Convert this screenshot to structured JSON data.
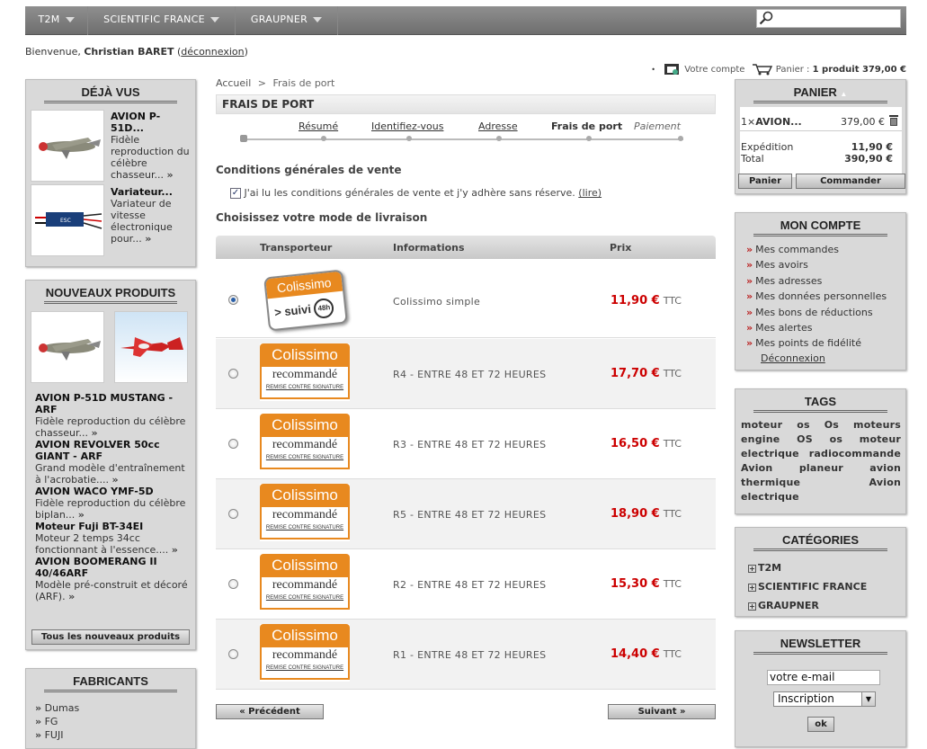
{
  "nav": {
    "items": [
      "T2M",
      "SCIENTIFIC FRANCE",
      "GRAUPNER"
    ]
  },
  "welcome": {
    "prefix": "Bienvenue, ",
    "name": "Christian BARET",
    "logout": "déconnexion"
  },
  "user_bar": {
    "account": "Votre compte",
    "cart_label": "Panier :",
    "cart_summary": "1 produit 379,00 €"
  },
  "breadcrumb": {
    "home": "Accueil",
    "sep": ">",
    "current": "Frais de port"
  },
  "page_title": "FRAIS DE PORT",
  "steps": [
    "Résumé",
    "Identifiez-vous",
    "Adresse",
    "Frais de port",
    "Paiement"
  ],
  "cgv": {
    "heading": "Conditions générales de vente",
    "text": "J'ai lu les conditions générales de vente et j'y adhère sans réserve.",
    "link": "(lire)"
  },
  "delivery_heading": "Choisissez votre mode de livraison",
  "table_headers": [
    "Transporteur",
    "Informations",
    "Prix"
  ],
  "carriers": [
    {
      "logo": "colissimo-suivi",
      "info": "Colissimo simple",
      "price": "11,90 €",
      "tax": "TTC",
      "selected": true
    },
    {
      "logo": "colissimo-recommande",
      "info": "R4 - ENTRE 48 ET 72 HEURES",
      "price": "17,70 €",
      "tax": "TTC",
      "selected": false
    },
    {
      "logo": "colissimo-recommande",
      "info": "R3 - ENTRE 48 ET 72 HEURES",
      "price": "16,50 €",
      "tax": "TTC",
      "selected": false
    },
    {
      "logo": "colissimo-recommande",
      "info": "R5 - ENTRE 48 ET 72 HEURES",
      "price": "18,90 €",
      "tax": "TTC",
      "selected": false
    },
    {
      "logo": "colissimo-recommande",
      "info": "R2 - ENTRE 48 ET 72 HEURES",
      "price": "15,30 €",
      "tax": "TTC",
      "selected": false
    },
    {
      "logo": "colissimo-recommande",
      "info": "R1 - ENTRE 48 ET 72 HEURES",
      "price": "14,40 €",
      "tax": "TTC",
      "selected": false
    }
  ],
  "logo_text": {
    "brand": "Colissimo",
    "suivi": "> suivi",
    "suivi_badge": "48h",
    "recommande": "recommandé",
    "remise": "REMISE CONTRE SIGNATURE"
  },
  "buttons": {
    "prev": "« Précédent",
    "next": "Suivant »"
  },
  "left": {
    "deja_vus": {
      "title": "DÉJÀ VUS",
      "items": [
        {
          "name": "AVION P-51D...",
          "desc": "Fidèle reproduction du célèbre chasseur..."
        },
        {
          "name": "Variateur...",
          "desc": "Variateur de vitesse électronique pour..."
        }
      ]
    },
    "nouveaux": {
      "title": "NOUVEAUX PRODUITS",
      "items": [
        {
          "name": "AVION P-51D MUSTANG - ARF",
          "desc": "Fidèle reproduction du célèbre chasseur..."
        },
        {
          "name": "AVION REVOLVER 50cc GIANT - ARF",
          "desc": "Grand modèle d'entraînement à l'acrobatie...."
        },
        {
          "name": "AVION WACO YMF-5D",
          "desc": "Fidèle reproduction du célèbre biplan..."
        },
        {
          "name": "Moteur Fuji BT-34EI",
          "desc": "Moteur 2 temps 34cc fonctionnant à l'essence...."
        },
        {
          "name": "AVION BOOMERANG II 40/46ARF",
          "desc": "Modèle pré-construit et décoré (ARF)."
        }
      ],
      "all_button": "Tous les nouveaux produits"
    },
    "fabricants": {
      "title": "FABRICANTS",
      "items": [
        "Dumas",
        "FG",
        "FUJI"
      ]
    }
  },
  "right": {
    "panier": {
      "title": "PANIER",
      "item_qty": "1×",
      "item_name": "AVION...",
      "item_price": "379,00 €",
      "expedition_label": "Expédition",
      "expedition_value": "11,90 €",
      "total_label": "Total",
      "total_value": "390,90 €",
      "btn_panier": "Panier",
      "btn_commander": "Commander"
    },
    "compte": {
      "title": "MON COMPTE",
      "items": [
        "Mes commandes",
        "Mes avoirs",
        "Mes adresses",
        "Mes données personnelles",
        "Mes bons de réductions",
        "Mes alertes",
        "Mes points de fidélité"
      ],
      "logout": "Déconnexion"
    },
    "tags": {
      "title": "TAGS",
      "lines": [
        "moteur os Os moteurs",
        "engine OS os moteur",
        "electrique radiocommande",
        "Avion planeur avion",
        "thermique Avion",
        "electrique"
      ]
    },
    "categories": {
      "title": "CATÉGORIES",
      "items": [
        "T2M",
        "SCIENTIFIC FRANCE",
        "GRAUPNER"
      ]
    },
    "newsletter": {
      "title": "NEWSLETTER",
      "email_value": "votre e-mail",
      "select_value": "Inscription",
      "ok": "ok"
    }
  }
}
